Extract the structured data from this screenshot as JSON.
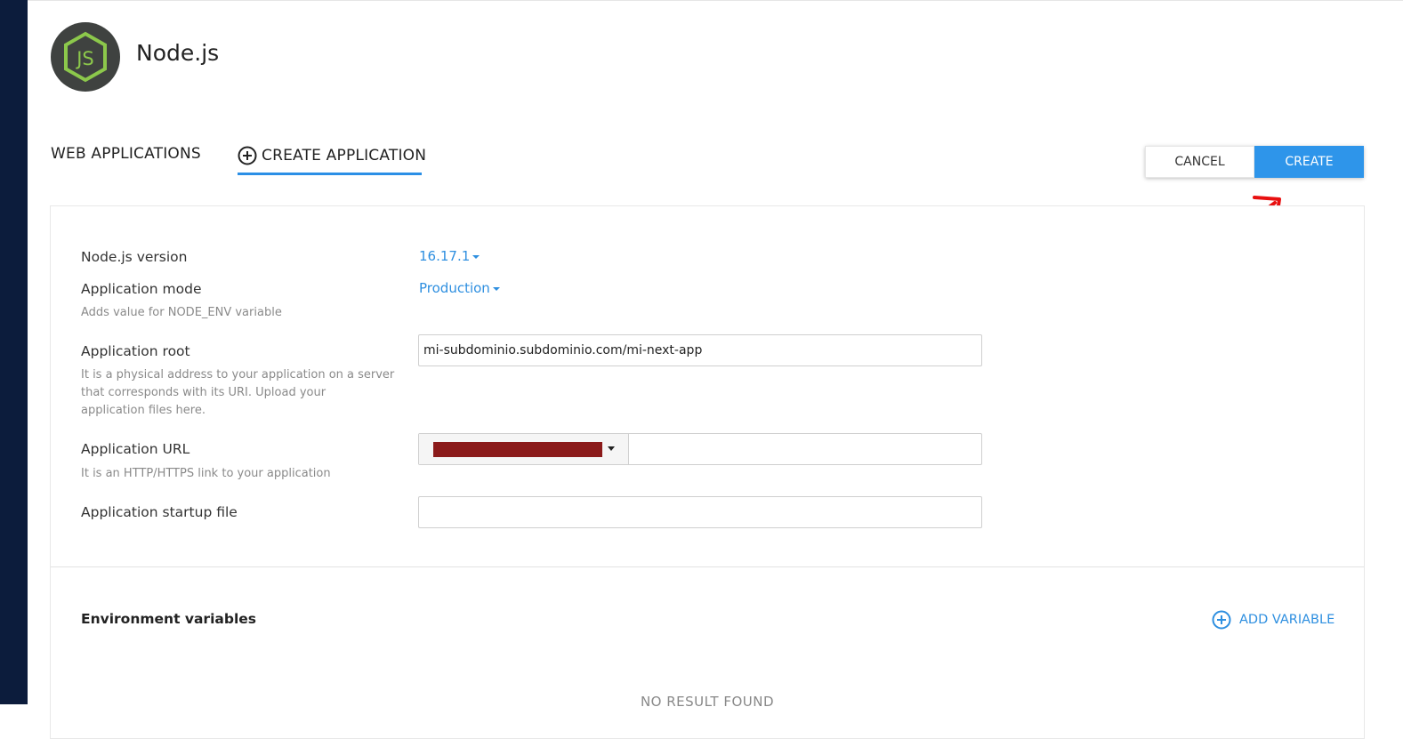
{
  "app": {
    "title": "Node.js",
    "logo_icon": "nodejs-logo-icon"
  },
  "tabs": {
    "web_applications": "WEB APPLICATIONS",
    "create_application": "CREATE APPLICATION"
  },
  "actions": {
    "cancel": "CANCEL",
    "create": "CREATE"
  },
  "form": {
    "nodejs_version": {
      "label": "Node.js version",
      "value": "16.17.1"
    },
    "application_mode": {
      "label": "Application mode",
      "value": "Production",
      "hint": "Adds value for NODE_ENV variable"
    },
    "application_root": {
      "label": "Application root",
      "value": "mi-subdominio.subdominio.com/mi-next-app",
      "hint_lines": [
        "It is a physical address to your application on a server",
        "that corresponds with its URI. Upload your",
        "application files here."
      ]
    },
    "application_url": {
      "label": "Application URL",
      "hint": "It is an HTTP/HTTPS link to your application",
      "value": ""
    },
    "startup_file": {
      "label": "Application startup file",
      "value": ""
    }
  },
  "env": {
    "title": "Environment variables",
    "add_label": "ADD VARIABLE",
    "empty_text": "NO RESULT FOUND"
  },
  "colors": {
    "accent": "#2e95ea",
    "sidebar": "#0c1c3c",
    "annotation_arrow": "#e81010",
    "redaction": "#8b1a1a"
  }
}
